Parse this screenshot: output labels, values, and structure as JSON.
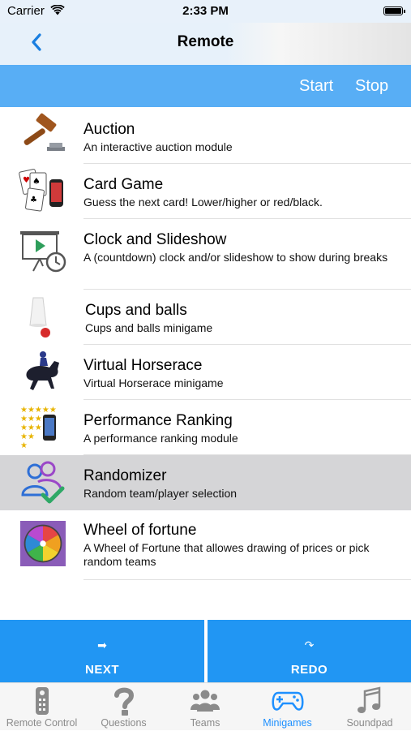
{
  "status_bar": {
    "carrier": "Carrier",
    "time": "2:33 PM"
  },
  "nav": {
    "title": "Remote"
  },
  "toolbar": {
    "start_label": "Start",
    "stop_label": "Stop"
  },
  "modules": [
    {
      "name": "Auction",
      "description": "An interactive auction module",
      "icon": "gavel-icon",
      "selected": false
    },
    {
      "name": "Card Game",
      "description": "Guess the next card! Lower/higher or red/black.",
      "icon": "playing-cards-icon",
      "selected": false
    },
    {
      "name": "Clock and Slideshow",
      "description": "A (countdown) clock and/or slideshow to show during breaks",
      "icon": "slideshow-clock-icon",
      "selected": false
    },
    {
      "name": "Cups and balls",
      "description": "Cups and balls minigame",
      "icon": "cup-ball-icon",
      "selected": false
    },
    {
      "name": "Virtual Horserace",
      "description": "Virtual Horserace minigame",
      "icon": "horse-jockey-icon",
      "selected": false
    },
    {
      "name": "Performance Ranking",
      "description": "A performance ranking module",
      "icon": "star-ranking-icon",
      "selected": false
    },
    {
      "name": "Randomizer",
      "description": "Random team/player selection",
      "icon": "users-check-icon",
      "selected": true
    },
    {
      "name": "Wheel of fortune",
      "description": "A Wheel of Fortune that allowes drawing of prices or pick random teams",
      "icon": "fortune-wheel-icon",
      "selected": false
    }
  ],
  "actions": {
    "next_label": "NEXT",
    "redo_label": "REDO"
  },
  "tabs": [
    {
      "label": "Remote Control",
      "icon": "remote-control-icon",
      "active": false
    },
    {
      "label": "Questions",
      "icon": "question-mark-icon",
      "active": false
    },
    {
      "label": "Teams",
      "icon": "teams-icon",
      "active": false
    },
    {
      "label": "Minigames",
      "icon": "gamepad-icon",
      "active": true
    },
    {
      "label": "Soundpad",
      "icon": "music-note-icon",
      "active": false
    }
  ],
  "colors": {
    "toolbar": "#58aef5",
    "action_button": "#2196f3",
    "active_tab": "#1e90ff",
    "back_chevron": "#1a7fe0"
  }
}
